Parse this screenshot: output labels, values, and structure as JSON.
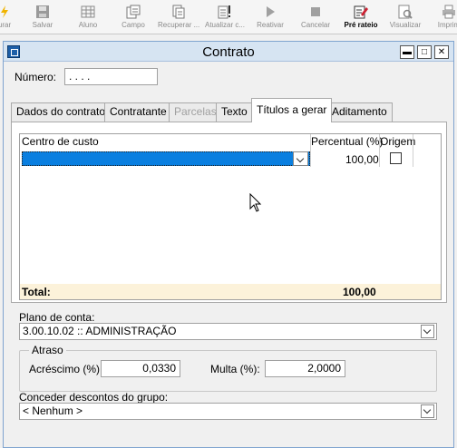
{
  "toolbar": {
    "items": [
      {
        "label": "urar",
        "icon": "lightning-icon",
        "active": false
      },
      {
        "label": "Salvar",
        "icon": "save-icon",
        "active": false
      },
      {
        "label": "Aluno",
        "icon": "grid-icon",
        "active": false
      },
      {
        "label": "Campo",
        "icon": "fields-icon",
        "active": false
      },
      {
        "label": "Recuperar ...",
        "icon": "recover-icon",
        "active": false
      },
      {
        "label": "Atualizar c...",
        "icon": "update-icon",
        "active": false
      },
      {
        "label": "Reativar",
        "icon": "play-icon",
        "active": false
      },
      {
        "label": "Cancelar",
        "icon": "stop-icon",
        "active": false
      },
      {
        "label": "Pré rateio",
        "icon": "edit-icon",
        "active": true
      },
      {
        "label": "Visualizar",
        "icon": "preview-icon",
        "active": false
      },
      {
        "label": "Imprim",
        "icon": "print-icon",
        "active": false
      }
    ]
  },
  "window": {
    "title": "Contrato",
    "minimize": "▬",
    "maximize": "□",
    "close": "✕"
  },
  "numero": {
    "label": "Número:",
    "value": " .  .      .  ."
  },
  "tabs": [
    {
      "label": "Dados do contrato",
      "state": "normal"
    },
    {
      "label": "Contratante",
      "state": "normal"
    },
    {
      "label": "Parcelas",
      "state": "disabled"
    },
    {
      "label": "Texto",
      "state": "normal"
    },
    {
      "label": "Títulos a gerar",
      "state": "active"
    },
    {
      "label": "Aditamento",
      "state": "normal"
    }
  ],
  "grid": {
    "headers": {
      "centro": "Centro de custo",
      "percentual": "Percentual (%)",
      "origem": "Origem"
    },
    "row": {
      "percentual": "100,00",
      "origem_checked": false
    },
    "footer": {
      "label": "Total:",
      "value": "100,00"
    }
  },
  "plano": {
    "label": "Plano de conta:",
    "value": "3.00.10.02 :: ADMINISTRAÇÃO"
  },
  "atraso": {
    "title": "Atraso",
    "acrescimo_label": "Acréscimo (%):",
    "acrescimo_value": "0,0330",
    "multa_label": "Multa (%):",
    "multa_value": "2,0000"
  },
  "descontos": {
    "label": "Conceder descontos do grupo:",
    "value": "< Nenhum >"
  }
}
